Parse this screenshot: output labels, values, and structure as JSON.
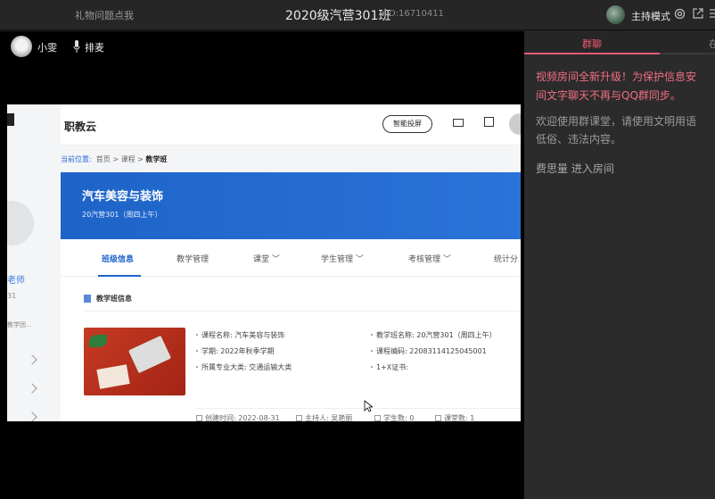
{
  "topbar": {
    "gift_label": "礼物问题点我",
    "room_title": "2020级汽营301班",
    "room_id": "ID:16710411",
    "host_mode": "主持模式"
  },
  "video": {
    "user_name": "小雯",
    "queue_label": "排麦"
  },
  "shared_screen": {
    "left_panel": {
      "label1": "老师",
      "label2": "31",
      "label3": "教学团..."
    },
    "brand": "职教云",
    "cast_button": "智能投屏",
    "breadcrumb": {
      "label": "当前位置:",
      "home": "首页",
      "sep": ">",
      "courses": "课程",
      "current": "教学班"
    },
    "course_title": "汽车美容与装饰",
    "class_info": "20汽营301（周四上午）",
    "tabs": [
      "班级信息",
      "教学管理",
      "课堂 ﹀",
      "学生管理 ﹀",
      "考核管理 ﹀",
      "统计分"
    ],
    "section_title": "教学班信息",
    "fields": {
      "course_name": "课程名称: 汽车美容与装饰",
      "semester": "学期: 2022年秋季学期",
      "major": "所属专业大类: 交通运输大类",
      "class_name": "教学班名称: 20汽营301（周四上午）",
      "course_code": "课程编码: 220831141250450​01",
      "certificate": "1+X证书:"
    },
    "meta": {
      "created": "创建时间: 2022-08-31",
      "host": "主持人: 吴艳丽",
      "students": "学生数: 0",
      "classes": "课堂数: 1"
    }
  },
  "chat_panel": {
    "tab_active": "群聊",
    "tab_other": "在",
    "warning": "视频房间全新升级！为保护信息安全，房间文字聊天不再与QQ群同步。",
    "warning_line1": "视频房间全新升级！为保护信息安",
    "warning_line2": "间文字聊天不再与QQ群同步。",
    "welcome_line1": "欢迎使用群课堂，请使用文明用语",
    "welcome_line2": "低俗、违法内容。",
    "join_message": "费思量 进入房间"
  },
  "colors": {
    "accent_pink": "#f05a74",
    "banner_blue": "#1e64c8"
  }
}
